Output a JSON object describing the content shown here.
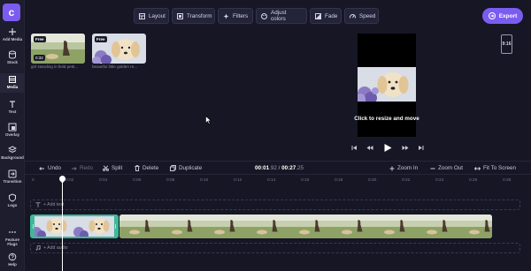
{
  "app": {
    "logo_letter": "c"
  },
  "rail": [
    {
      "id": "add-media",
      "label": "Add Media",
      "icon": "plus-icon"
    },
    {
      "id": "stock",
      "label": "Stock",
      "icon": "database-icon"
    },
    {
      "id": "media",
      "label": "Media",
      "icon": "film-icon",
      "active": true
    },
    {
      "id": "text",
      "label": "Text",
      "icon": "text-icon"
    },
    {
      "id": "overlay",
      "label": "Overlay",
      "icon": "overlay-icon"
    },
    {
      "id": "background",
      "label": "Background",
      "icon": "layers-icon"
    },
    {
      "id": "transition",
      "label": "Transition",
      "icon": "transition-icon"
    },
    {
      "id": "logo",
      "label": "Logo",
      "icon": "shield-icon"
    },
    {
      "id": "feature-flags",
      "label": "Feature Flags",
      "icon": "more-icon"
    },
    {
      "id": "help",
      "label": "Help",
      "icon": "help-icon"
    }
  ],
  "toolbar": {
    "layout": "Layout",
    "transform": "Transform",
    "filters": "Filters",
    "adjust_colors": "Adjust colors",
    "fade": "Fade",
    "speed": "Speed",
    "export": "Export"
  },
  "library": [
    {
      "badge": "Free",
      "duration": "0:32",
      "caption": "girl standing in field petti..."
    },
    {
      "badge": "Free",
      "duration": "",
      "caption": "beautiful little golden re..."
    }
  ],
  "preview": {
    "resize_label": "Click to resize and move",
    "aspect_ratio": "9:16"
  },
  "timeline": {
    "undo": "Undo",
    "redo": "Redo",
    "split": "Split",
    "delete": "Delete",
    "duplicate": "Duplicate",
    "current_time": "00:01",
    "current_frac": ".92",
    "separator": " / ",
    "total_time": "00:27",
    "total_frac": ".25",
    "zoom_in": "Zoom In",
    "zoom_out": "Zoom Out",
    "fit": "Fit To Screen",
    "ticks": [
      "0",
      "0:02",
      "0:04",
      "0:06",
      "0:08",
      "0:10",
      "0:12",
      "0:14",
      "0:16",
      "0:18",
      "0:20",
      "0:22",
      "0:24",
      "0:26",
      "0:28"
    ],
    "add_text": "+ Add text",
    "add_audio": "+ Add audio"
  },
  "colors": {
    "accent": "#7b5cf0",
    "background": "#161625",
    "selected_clip": "#3fb89a"
  }
}
